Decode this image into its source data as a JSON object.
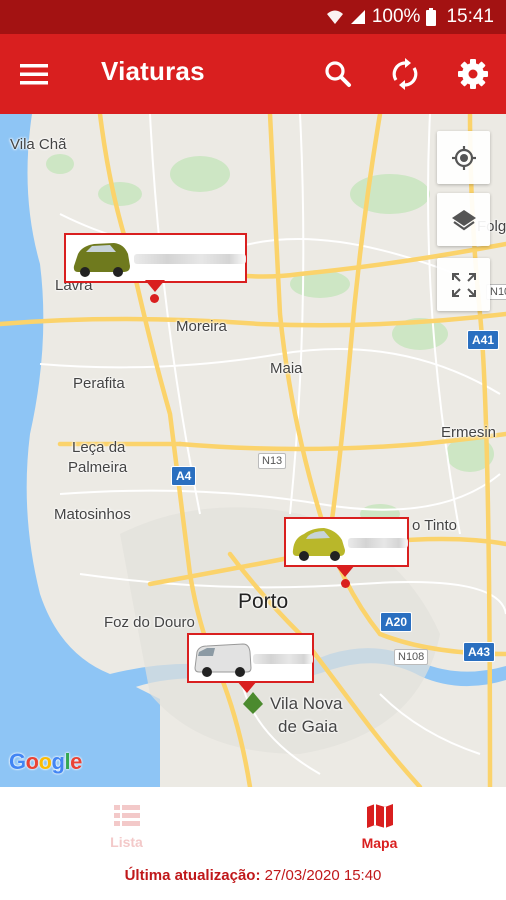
{
  "status_bar": {
    "battery": "100%",
    "time": "15:41"
  },
  "app_bar": {
    "title": "Viaturas",
    "icons": [
      "menu-icon",
      "search-icon",
      "sync-icon",
      "settings-icon"
    ]
  },
  "map": {
    "places": {
      "vila_cha": "Vila Chã",
      "lavra": "Lavra",
      "moreira": "Moreira",
      "perafita": "Perafita",
      "maia": "Maia",
      "leca_1": "Leça da",
      "leca_2": "Palmeira",
      "matosinhos": "Matosinhos",
      "ermesinde": "Ermesin",
      "rio_tinto": "o Tinto",
      "porto": "Porto",
      "foz": "Foz do Douro",
      "gaia_1": "Vila Nova",
      "gaia_2": "de Gaia",
      "folgosa": "Folg"
    },
    "roads": {
      "a41": "A41",
      "a4": "A4",
      "n13": "N13",
      "a20": "A20",
      "a43": "A43",
      "n108": "N108",
      "n10": "N10"
    },
    "attribution": {
      "g1": "G",
      "o1": "o",
      "o2": "o",
      "g2": "g",
      "l": "l",
      "e": "e"
    },
    "controls": [
      "my-location-icon",
      "layers-icon",
      "fullscreen-icon"
    ],
    "colors": {
      "accent": "#d91f1f",
      "status": "#a31212",
      "water": "#8ec5f5",
      "road": "#fbd36b"
    }
  },
  "bottom_nav": {
    "tabs": [
      {
        "label": "Lista",
        "active": false
      },
      {
        "label": "Mapa",
        "active": true
      }
    ]
  },
  "footer": {
    "label": "Última atualização:",
    "value": "27/03/2020 15:40"
  }
}
